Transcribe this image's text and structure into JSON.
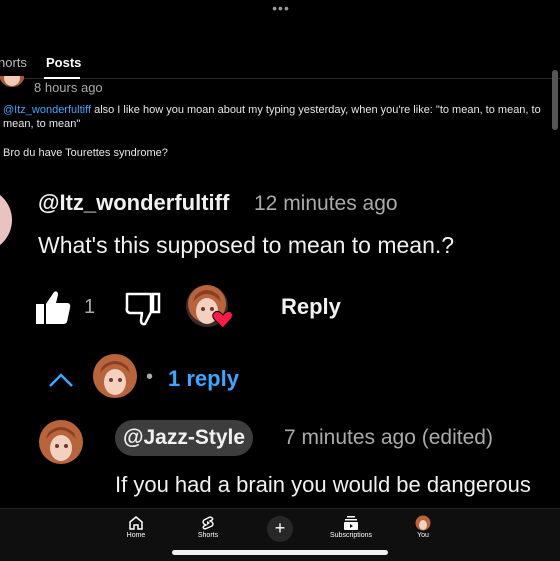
{
  "tabs": {
    "shorts": "horts",
    "posts": "Posts"
  },
  "post": {
    "time": "8 hours ago",
    "mention": "@Itz_wonderfultiff",
    "text": " also I like how you moan about my typing yesterday, when you're like: \"to mean, to mean, to mean, to mean\"",
    "text2": "Bro du have Tourettes syndrome?"
  },
  "comment": {
    "author": "@Itz_wonderfultiff",
    "time": "12 minutes ago",
    "body": "What's this supposed to mean to mean.?",
    "like_count": "1",
    "reply_label": "Reply"
  },
  "replies": {
    "count_label": "1 reply",
    "separator": "•"
  },
  "reply": {
    "author": "@Jazz-Style",
    "time": "7 minutes ago (edited)",
    "body": "If you had a brain you would be dangerous"
  },
  "nav": {
    "home": "Home",
    "shorts": "Shorts",
    "create": "+",
    "subscriptions": "Subscriptions",
    "you": "You"
  },
  "colors": {
    "link": "#3ea6ff",
    "heart": "#ff1a4a",
    "background": "#000000"
  }
}
